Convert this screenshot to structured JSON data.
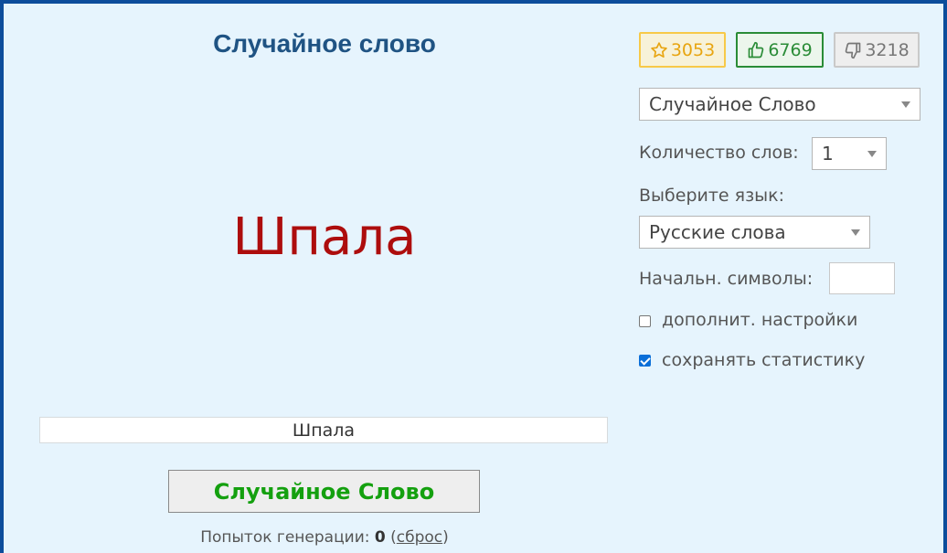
{
  "main": {
    "title": "Случайное слово",
    "word": "Шпала",
    "word_field_value": "Шпала",
    "generate_button": "Случайное Слово",
    "attempts_label": "Попыток генерации:",
    "attempts_count": "0",
    "reset_link": "сброс"
  },
  "votes": {
    "favorites": "3053",
    "likes": "6769",
    "dislikes": "3218"
  },
  "settings": {
    "mode_selected": "Случайное Слово",
    "count_label": "Количество слов:",
    "count_selected": "1",
    "language_label": "Выберите язык:",
    "language_selected": "Русские слова",
    "start_chars_label": "Начальн. символы:",
    "start_chars_value": "",
    "advanced_label": "дополнит. настройки",
    "advanced_checked": false,
    "save_stats_label": "сохранять статистику",
    "save_stats_checked": true
  },
  "colors": {
    "frame_border": "#0d4d9b",
    "background": "#e6f4fd",
    "title": "#1f5383",
    "word": "#ad0d0d",
    "button_text": "#14a00f",
    "star": "#e8a511",
    "like": "#2a8c37",
    "dislike": "#777777"
  },
  "icons": {
    "favorites": "star-outline-icon",
    "likes": "thumbs-up-icon",
    "dislikes": "thumbs-down-icon",
    "dropdown": "caret-down-icon"
  }
}
